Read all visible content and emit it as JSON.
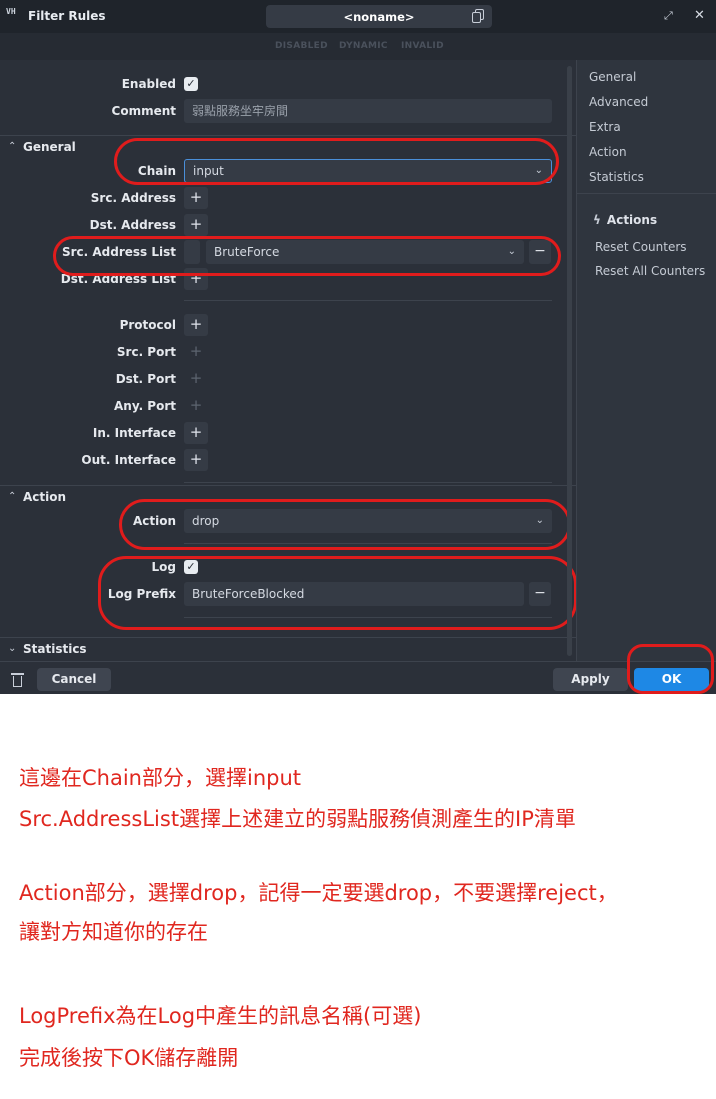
{
  "window": {
    "title": "Filter Rules",
    "app_icon": "VH",
    "name": "<noname>",
    "flags": [
      "DISABLED",
      "DYNAMIC",
      "INVALID"
    ]
  },
  "form": {
    "enabled_label": "Enabled",
    "enabled_checked": true,
    "comment_label": "Comment",
    "comment_value": "弱點服務坐牢房間",
    "sections": {
      "general": "General",
      "action": "Action",
      "statistics": "Statistics"
    },
    "chain_label": "Chain",
    "chain_value": "input",
    "src_address_label": "Src. Address",
    "dst_address_label": "Dst. Address",
    "src_address_list_label": "Src. Address List",
    "src_address_list_value": "BruteForce",
    "dst_address_list_label": "Dst. Address List",
    "protocol_label": "Protocol",
    "src_port_label": "Src. Port",
    "dst_port_label": "Dst. Port",
    "any_port_label": "Any. Port",
    "in_interface_label": "In. Interface",
    "out_interface_label": "Out. Interface",
    "action_label": "Action",
    "action_value": "drop",
    "log_label": "Log",
    "log_checked": true,
    "log_prefix_label": "Log Prefix",
    "log_prefix_value": "BruteForceBlocked"
  },
  "sidebar": {
    "nav": [
      "General",
      "Advanced",
      "Extra",
      "Action",
      "Statistics"
    ],
    "actions_title": "Actions",
    "actions": [
      "Reset Counters",
      "Reset All Counters"
    ]
  },
  "buttons": {
    "cancel": "Cancel",
    "apply": "Apply",
    "ok": "OK"
  },
  "instructions": [
    "這邊在Chain部分，選擇input",
    "Src.AddressList選擇上述建立的弱點服務偵測產生的IP清單",
    "Action部分，選擇drop，記得一定要選drop，不要選擇reject，",
    "讓對方知道你的存在",
    "LogPrefix為在Log中產生的訊息名稱(可選)",
    "完成後按下OK儲存離開"
  ],
  "colors": {
    "window_bg": "#2b3039",
    "accent_blue": "#1e88e5",
    "annotation_red": "#e01c1c",
    "instruction_red": "#e0271f"
  }
}
